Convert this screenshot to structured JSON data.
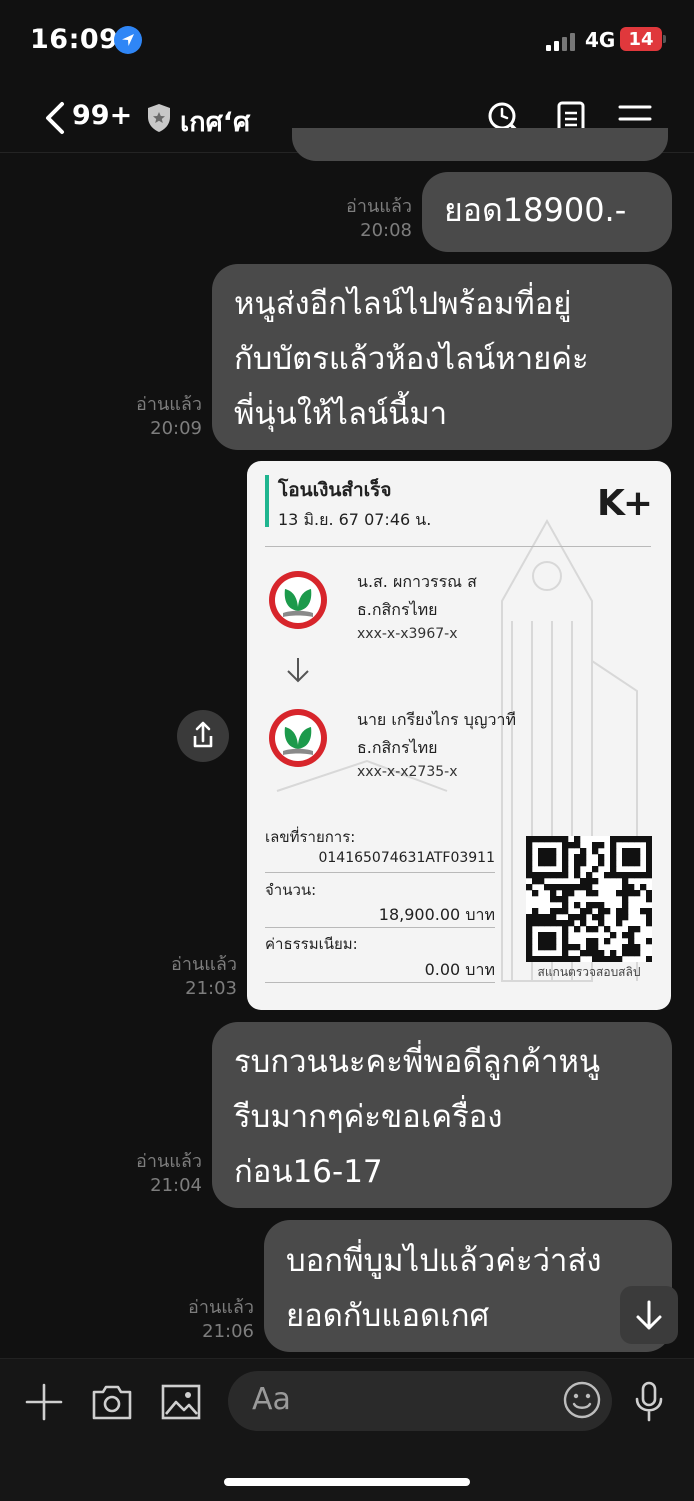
{
  "status_bar": {
    "time": "16:09",
    "network": "4G",
    "battery": "14"
  },
  "header": {
    "unread_count": "99+",
    "title": "เกศ‘ศ"
  },
  "messages": [
    {
      "text": "ยอด18900.-",
      "read": "อ่านแล้ว",
      "time": "20:08"
    },
    {
      "text": "หนูส่งอีกไลน์ไปพร้อมที่อยู่\nกับบัตรแล้วห้องไลน์หายค่ะ\nพี่นุ่นให้ไลน์นี้มา",
      "read": "อ่านแล้ว",
      "time": "20:09"
    },
    {
      "read": "อ่านแล้ว",
      "time": "21:03"
    },
    {
      "text": "รบกวนนะคะพี่พอดีลูกค้าหนู\nรีบมากๆค่ะขอเครื่อง\nก่อน16-17",
      "read": "อ่านแล้ว",
      "time": "21:04"
    },
    {
      "text": "บอกพี่บูมไปแล้วค่ะว่าส่ง\nยอดกับแอดเกศ",
      "read": "อ่านแล้ว",
      "time": "21:06"
    }
  ],
  "slip": {
    "heading": "โอนเงินสำเร็จ",
    "datetime": "13 มิ.ย. 67  07:46 น.",
    "brand": "K+",
    "sender": {
      "name": "น.ส. ผกาวรรณ ส",
      "bank": "ธ.กสิกรไทย",
      "account": "xxx-x-x3967-x"
    },
    "receiver": {
      "name": "นาย เกรียงไกร บุญวาที",
      "bank": "ธ.กสิกรไทย",
      "account": "xxx-x-x2735-x"
    },
    "ref_label": "เลขที่รายการ:",
    "ref_value": "014165074631ATF03911",
    "amount_label": "จำนวน:",
    "amount_value": "18,900.00 บาท",
    "fee_label": "ค่าธรรมเนียม:",
    "fee_value": "0.00 บาท",
    "qr_caption": "สแกนตรวจสอบสลิป"
  },
  "composer": {
    "placeholder": "Aa"
  },
  "colors": {
    "bubble": "#4a4a4a",
    "background": "#111111",
    "kbank_green": "#1c9a4b",
    "kbank_red": "#d7252b"
  }
}
